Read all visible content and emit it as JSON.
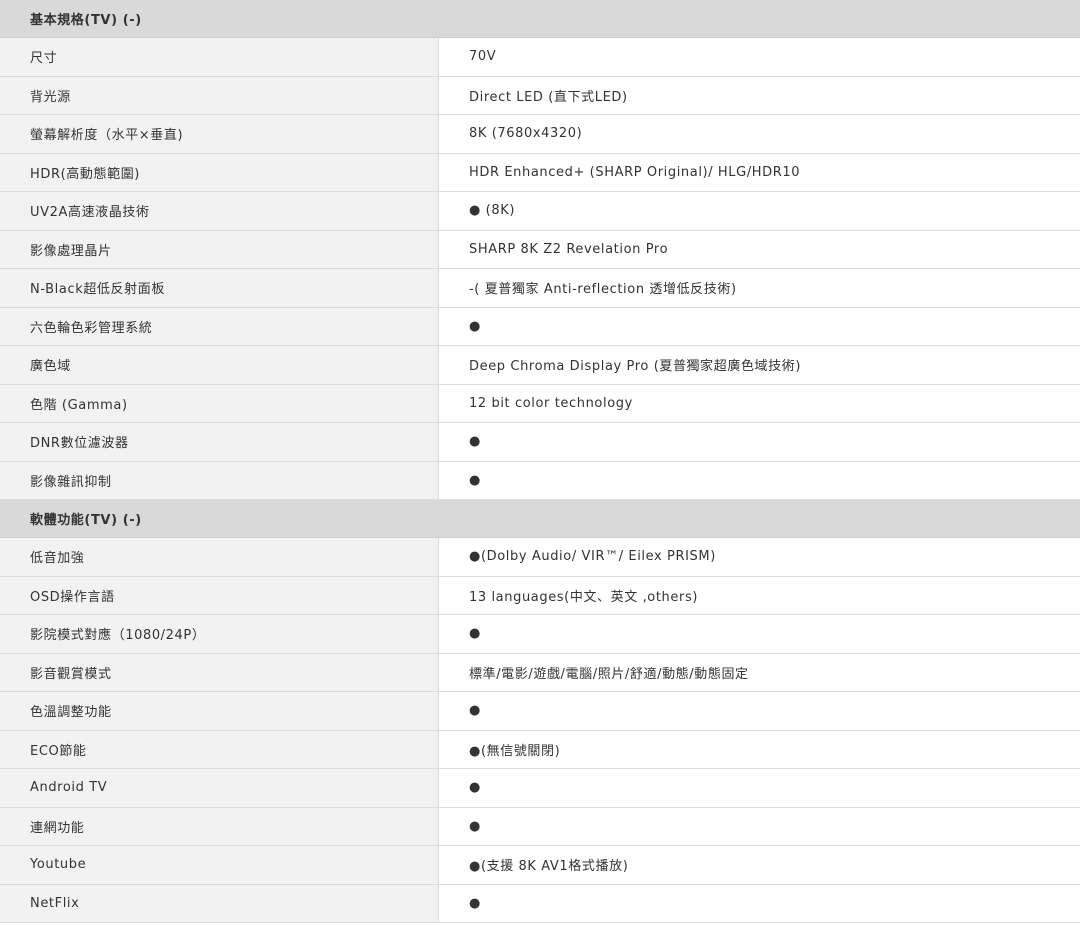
{
  "sections": [
    {
      "title": "基本規格(TV) (-)",
      "rows": [
        {
          "label": "尺寸",
          "value": "70V"
        },
        {
          "label": "背光源",
          "value": "Direct LED (直下式LED)"
        },
        {
          "label": "螢幕解析度（水平×垂直)",
          "value": "8K (7680x4320)"
        },
        {
          "label": "HDR(高動態範圍)",
          "value": "HDR Enhanced+ (SHARP Original)/ HLG/HDR10"
        },
        {
          "label": "UV2A高速液晶技術",
          "value": "● (8K)"
        },
        {
          "label": "影像處理晶片",
          "value": "SHARP 8K Z2 Revelation Pro"
        },
        {
          "label": "N-Black超低反射面板",
          "value": "-( 夏普獨家 Anti-reflection 透增低反技術)"
        },
        {
          "label": "六色輪色彩管理系統",
          "value": "●"
        },
        {
          "label": "廣色域",
          "value": "Deep Chroma Display Pro (夏普獨家超廣色域技術)"
        },
        {
          "label": "色階 (Gamma)",
          "value": "12 bit color technology"
        },
        {
          "label": "DNR數位濾波器",
          "value": "●"
        },
        {
          "label": "影像雜訊抑制",
          "value": "●"
        }
      ]
    },
    {
      "title": "軟體功能(TV) (-)",
      "rows": [
        {
          "label": "低音加強",
          "value": "●(Dolby Audio/ VIR™/ Eilex PRISM)"
        },
        {
          "label": "OSD操作言語",
          "value": "13 languages(中文、英文 ,others)"
        },
        {
          "label": "影院模式對應（1080/24P）",
          "value": "●"
        },
        {
          "label": "影音觀賞模式",
          "value": "標準/電影/遊戲/電腦/照片/舒適/動態/動態固定"
        },
        {
          "label": "色溫調整功能",
          "value": "●"
        },
        {
          "label": "ECO節能",
          "value": "●(無信號關閉)"
        },
        {
          "label": "Android TV",
          "value": "●"
        },
        {
          "label": "連網功能",
          "value": "●"
        },
        {
          "label": "Youtube",
          "value": "●(支援 8K AV1格式播放)"
        },
        {
          "label": "NetFlix",
          "value": "●"
        }
      ]
    }
  ]
}
